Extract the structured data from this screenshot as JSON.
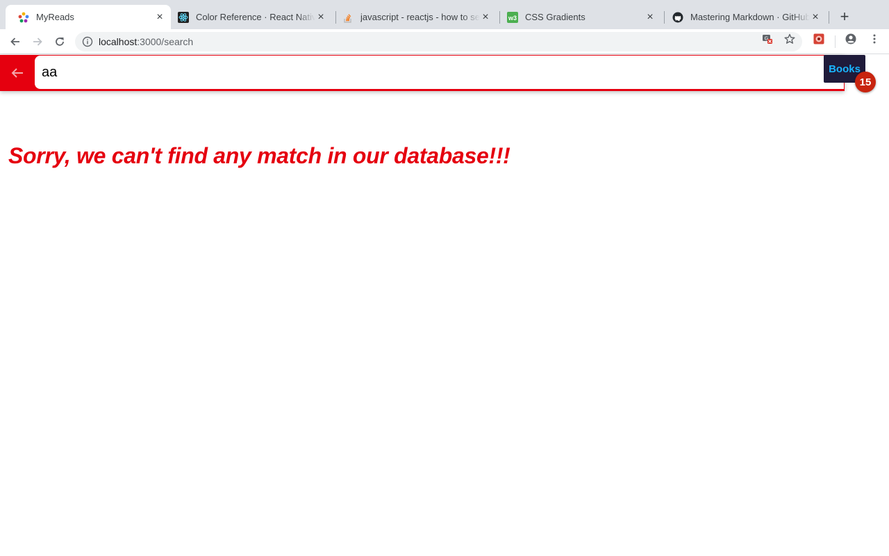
{
  "browser": {
    "tabs": [
      {
        "title": "MyReads",
        "icon": "react-app-favicon",
        "active": true
      },
      {
        "title": "Color Reference · React Native",
        "icon": "react-native-favicon",
        "active": false
      },
      {
        "title": "javascript - reactjs - how to set",
        "icon": "stackoverflow-favicon",
        "active": false
      },
      {
        "title": "CSS Gradients",
        "icon": "w3schools-favicon",
        "active": false
      },
      {
        "title": "Mastering Markdown · GitHub",
        "icon": "github-favicon",
        "active": false
      }
    ],
    "new_tab_label": "+",
    "close_glyph": "×",
    "url_host": "localhost",
    "url_path": ":3000/search"
  },
  "app": {
    "search_value": "aa",
    "books_label": "Books",
    "books_count": "15",
    "no_match_message": "Sorry, we can't find any match in our database!!!",
    "colors": {
      "header_red": "#e5000f",
      "books_bg": "#1f1b3a",
      "books_text": "#19b5ff",
      "badge": "#c8240f"
    }
  }
}
